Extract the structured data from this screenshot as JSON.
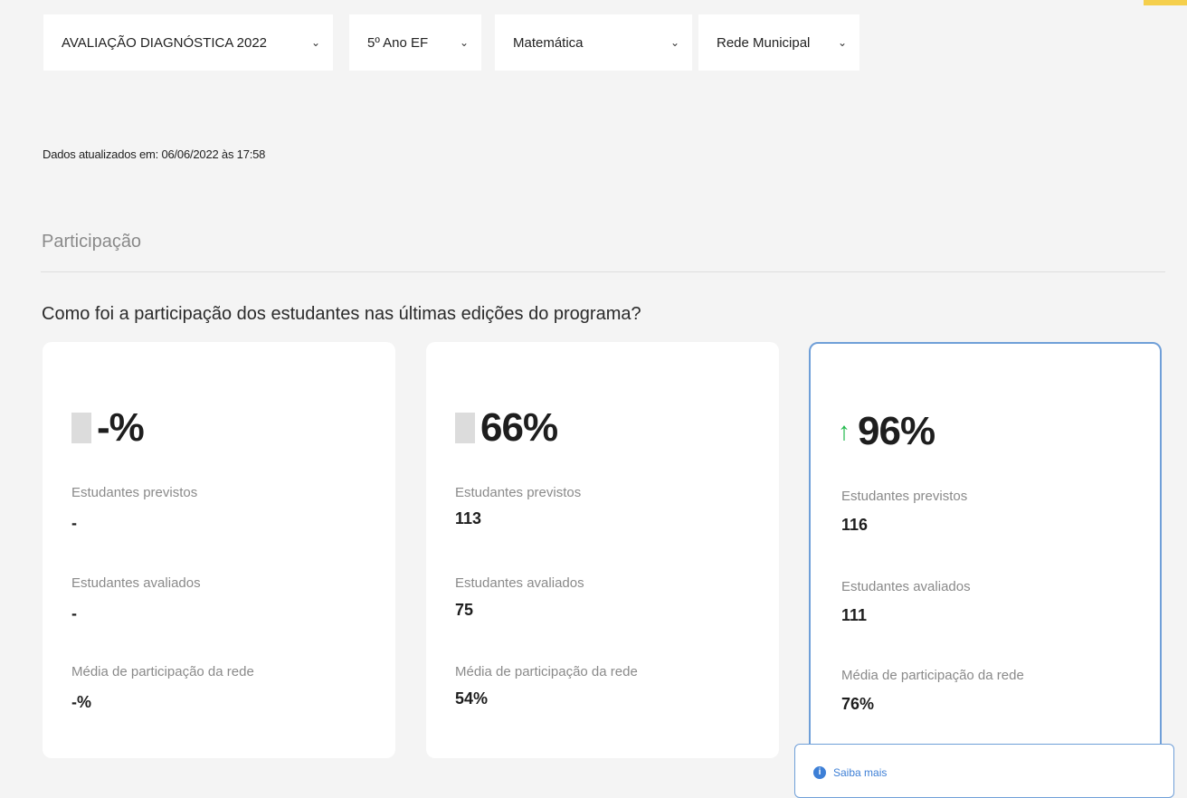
{
  "filters": {
    "evaluation": "AVALIAÇÃO DIAGNÓSTICA 2022",
    "grade": "5º Ano EF",
    "subject": "Matemática",
    "network": "Rede Municipal"
  },
  "updated_text": "Dados atualizados em: 06/06/2022 às 17:58",
  "section_title": "Participação",
  "question": "Como foi a participação dos estudantes nas últimas edições do programa?",
  "labels": {
    "expected": "Estudantes previstos",
    "evaluated": "Estudantes avaliados",
    "network_average": "Média de participação da rede"
  },
  "cards": [
    {
      "percent": "-%",
      "trend": "none",
      "expected": "-",
      "evaluated": "-",
      "network_average": "-%"
    },
    {
      "percent": "66%",
      "trend": "none",
      "expected": "113",
      "evaluated": "75",
      "network_average": "54%"
    },
    {
      "percent": "96%",
      "trend": "up",
      "expected": "116",
      "evaluated": "111",
      "network_average": "76%"
    }
  ],
  "saiba_mais": "Saiba mais",
  "colors": {
    "accent": "#3d7fd6",
    "up": "#1fb84a",
    "highlight_border": "#6f9fd8"
  },
  "icons": {
    "dropdown": "chevron-down-icon",
    "trend_up": "arrow-up-icon",
    "info": "info-icon"
  }
}
